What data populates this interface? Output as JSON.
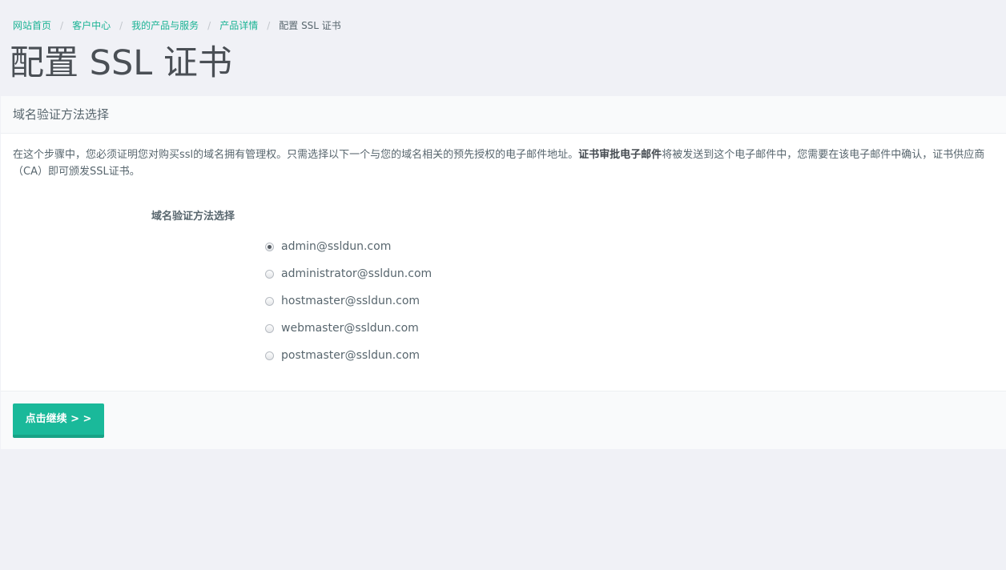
{
  "breadcrumb": {
    "items": [
      "网站首页",
      "客户中心",
      "我的产品与服务",
      "产品详情"
    ],
    "separator": "/",
    "current": "配置 SSL 证书"
  },
  "page": {
    "title": "配置 SSL 证书"
  },
  "panel": {
    "heading": "域名验证方法选择",
    "intro_before": "在这个步骤中，您必须证明您对购买ssl的域名拥有管理权。只需选择以下一个与您的域名相关的预先授权的电子邮件地址。",
    "intro_bold": "证书审批电子邮件",
    "intro_after": "将被发送到这个电子邮件中，您需要在该电子邮件中确认，证书供应商（CA）即可颁发SSL证书。"
  },
  "form": {
    "label": "域名验证方法选择",
    "options": [
      {
        "email": "admin@ssldun.com",
        "checked": true
      },
      {
        "email": "administrator@ssldun.com",
        "checked": false
      },
      {
        "email": "hostmaster@ssldun.com",
        "checked": false
      },
      {
        "email": "webmaster@ssldun.com",
        "checked": false
      },
      {
        "email": "postmaster@ssldun.com",
        "checked": false
      }
    ]
  },
  "footer": {
    "continue_label": "点击继续 > >"
  },
  "colors": {
    "accent": "#1ab394",
    "button": "#1ab99a",
    "page_bg": "#f0f1f6",
    "text": "#58666e"
  }
}
